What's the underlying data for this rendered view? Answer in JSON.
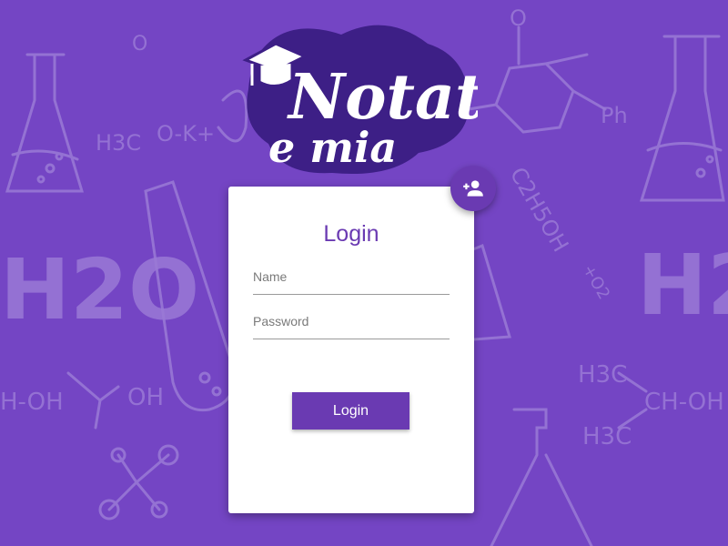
{
  "logo": {
    "text_line1": "Notat",
    "text_line2": "e mia"
  },
  "login_card": {
    "title": "Login",
    "name_placeholder": "Name",
    "password_placeholder": "Password",
    "submit_label": "Login"
  },
  "fab": {
    "icon": "add-user-icon"
  },
  "background": {
    "doodles": [
      "O",
      "H3C",
      "O-K+",
      "H2O",
      "H-OH",
      "OH",
      "C2H5OH",
      "Ph",
      "H3C",
      "CH-OH",
      "H3C",
      "O2"
    ]
  },
  "colors": {
    "background": "#7445c4",
    "accent": "#6a3ab2",
    "card": "#ffffff"
  }
}
